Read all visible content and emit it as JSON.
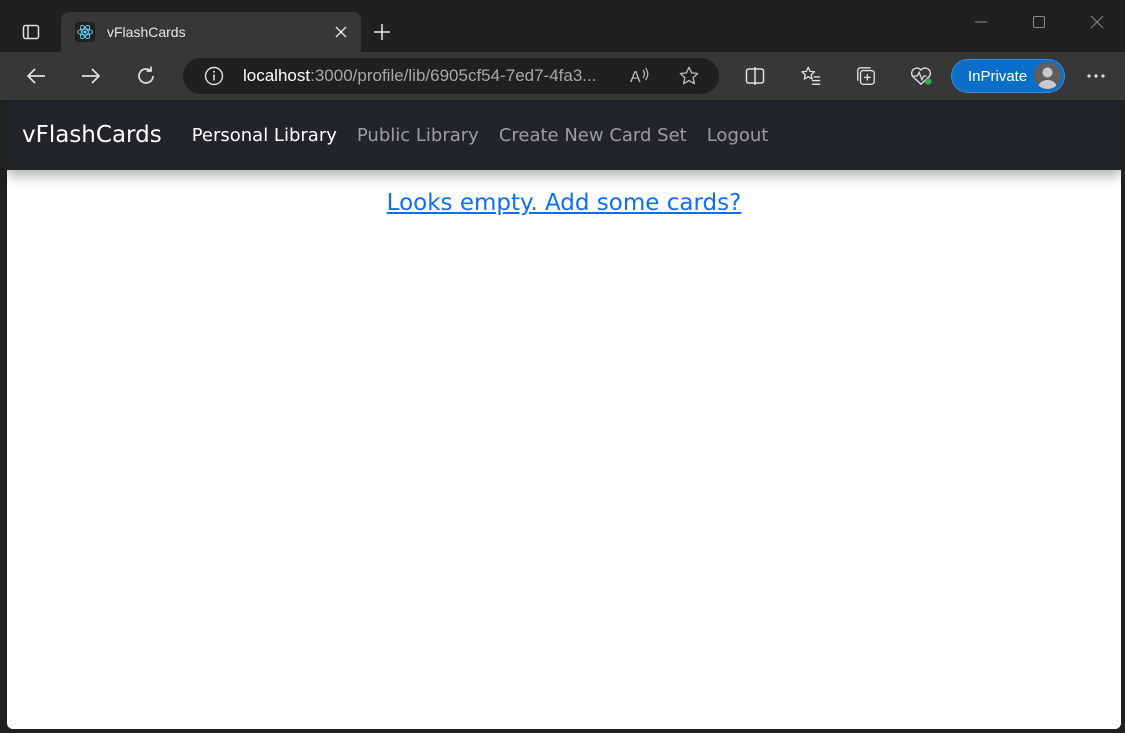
{
  "browser": {
    "tab": {
      "title": "vFlashCards",
      "favicon": "react-icon",
      "close_icon": "close-icon"
    },
    "new_tab_icon": "plus-icon",
    "window_controls": [
      "minimize-icon",
      "maximize-icon",
      "close-icon"
    ],
    "toolbar": {
      "back_icon": "back-arrow-icon",
      "forward_icon": "forward-arrow-icon",
      "refresh_icon": "refresh-icon",
      "address": {
        "host": "localhost",
        "path": ":3000/profile/lib/6905cf54-7ed7-4fa3..."
      },
      "read_aloud_icon": "read-aloud-icon",
      "favorite_icon": "star-icon",
      "split_screen_icon": "split-screen-icon",
      "favorites_icon": "favorites-list-icon",
      "collections_icon": "collections-icon",
      "health_icon": "browser-essentials-icon",
      "inprivate_label": "InPrivate",
      "more_icon": "more-icon"
    },
    "colors": {
      "frame": "#202020",
      "toolbar": "#373737",
      "inprivate": "#0b6fc9"
    }
  },
  "app": {
    "brand": "vFlashCards",
    "nav": [
      {
        "label": "Personal Library",
        "active": true
      },
      {
        "label": "Public Library",
        "active": false
      },
      {
        "label": "Create New Card Set",
        "active": false
      },
      {
        "label": "Logout",
        "active": false
      }
    ],
    "empty_message": "Looks empty. Add some cards?",
    "colors": {
      "navbar": "#212529",
      "link": "#0d6efd"
    }
  }
}
